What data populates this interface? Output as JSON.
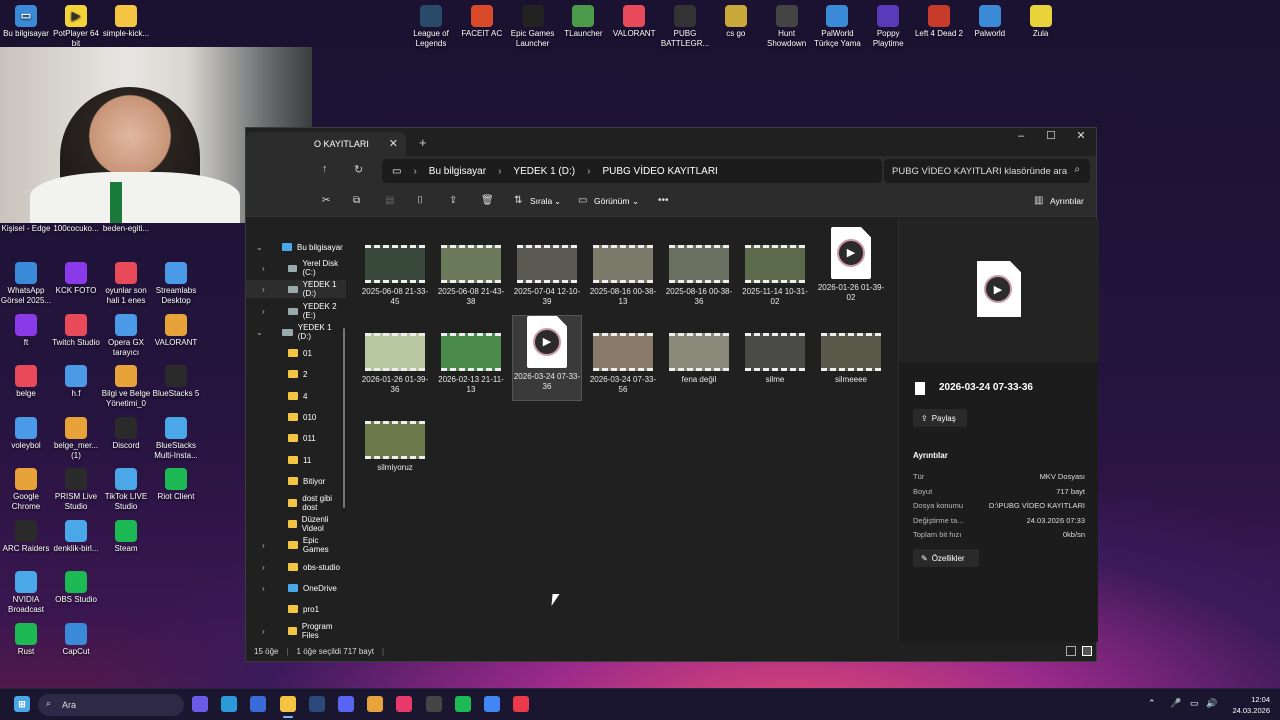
{
  "desktop": {
    "top_left_icons": [
      "Bu bilgisayar",
      "PotPlayer 64 bit",
      "simple-kick..."
    ],
    "top_apps": [
      "League of Legends",
      "FACEIT AC",
      "Epic Games Launcher",
      "TLauncher",
      "VALORANT",
      "PUBG BATTLEGR...",
      "cs go",
      "Hunt Showdown",
      "PalWorld Türkçe Yama",
      "Poppy Playtime",
      "Left 4 Dead 2",
      "Palworld",
      "Zula"
    ],
    "left_row0": [
      "Kişisel - Edge",
      "100cocuko...",
      "beden-egiti..."
    ],
    "left_grid": [
      [
        "WhatsApp Görsel 2025...",
        "KCK FOTO",
        "oyunlar son hali 1 enes",
        "Streamlabs Desktop"
      ],
      [
        "ft",
        "Twitch Studio",
        "Opera GX tarayıcı",
        "VALORANT"
      ],
      [
        "belge",
        "h.f",
        "Bilgi ve Belge Yönetimi_0",
        "BlueStacks 5"
      ],
      [
        "voleybol",
        "belge_mer... (1)",
        "Discord",
        "BlueStacks Multi-Insta..."
      ],
      [
        "Google Chrome",
        "PRISM Live Studio",
        "TikTok LIVE Studio",
        "Riot Client"
      ],
      [
        "ARC Raiders",
        "denklik-birl...",
        "Steam",
        ""
      ],
      [
        "NVIDIA Broadcast",
        "OBS Studio",
        "",
        ""
      ],
      [
        "Rust",
        "CapCut",
        "",
        ""
      ]
    ]
  },
  "explorer": {
    "tab_title": "O KAYITLARI",
    "breadcrumb": [
      "Bu bilgisayar",
      "YEDEK 1 (D:)",
      "PUBG VİDEO KAYITLARI"
    ],
    "search_placeholder": "PUBG VİDEO KAYITLARI klasöründe ara",
    "sort_label": "Sırala",
    "view_label": "Görünüm",
    "details_toggle": "Ayrıntılar",
    "nav": [
      {
        "label": "Bu bilgisayar",
        "type": "pc",
        "expanded": true
      },
      {
        "label": "Yerel Disk (C:)",
        "type": "drive"
      },
      {
        "label": "YEDEK 1 (D:)",
        "type": "drive",
        "selected": true
      },
      {
        "label": "YEDEK 2 (E:)",
        "type": "drive"
      },
      {
        "label": "YEDEK 1 (D:)",
        "type": "drive",
        "expanded": true
      },
      {
        "label": "01",
        "type": "folder"
      },
      {
        "label": "2",
        "type": "folder"
      },
      {
        "label": "4",
        "type": "folder"
      },
      {
        "label": "010",
        "type": "folder"
      },
      {
        "label": "011",
        "type": "folder"
      },
      {
        "label": "11",
        "type": "folder"
      },
      {
        "label": "Bitiyor",
        "type": "folder"
      },
      {
        "label": "dost gibi dost",
        "type": "folder"
      },
      {
        "label": "Düzenli Videol",
        "type": "folder"
      },
      {
        "label": "Epic Games",
        "type": "folder"
      },
      {
        "label": "obs-studio",
        "type": "folder"
      },
      {
        "label": "OneDrive",
        "type": "cloud"
      },
      {
        "label": "pro1",
        "type": "folder"
      },
      {
        "label": "Program Files",
        "type": "folder"
      }
    ],
    "files": [
      {
        "name": "2025-06-08 21-33-45",
        "kind": "video",
        "color": "#3a4a3a"
      },
      {
        "name": "2025-06-08 21-43-38",
        "kind": "video",
        "color": "#6a7a5a"
      },
      {
        "name": "2025-07-04 12-10-39",
        "kind": "video",
        "color": "#5a5a52"
      },
      {
        "name": "2025-08-16 00-38-13",
        "kind": "video",
        "color": "#7a7a6a"
      },
      {
        "name": "2025-08-16 00-38-36",
        "kind": "video",
        "color": "#6a7060"
      },
      {
        "name": "2025-11-14 10-31-02",
        "kind": "video",
        "color": "#5a6a4a"
      },
      {
        "name": "2026-01-26 01-39-02",
        "kind": "doc"
      },
      {
        "name": "2026-01-26 01-39-36",
        "kind": "video",
        "color": "#b8c8a0"
      },
      {
        "name": "2026-02-13 21-11-13",
        "kind": "video",
        "color": "#4a8a4a"
      },
      {
        "name": "2026-03-24 07-33-36",
        "kind": "doc",
        "selected": true
      },
      {
        "name": "2026-03-24 07-33-56",
        "kind": "video",
        "color": "#8a7a6a"
      },
      {
        "name": "fena değil",
        "kind": "video",
        "color": "#8a8a7a"
      },
      {
        "name": "silme",
        "kind": "video",
        "color": "#4a4a48"
      },
      {
        "name": "silmeeee",
        "kind": "video",
        "color": "#5a5a4a"
      },
      {
        "name": "silmiyoruz",
        "kind": "video",
        "color": "#6a7a4a"
      }
    ],
    "details": {
      "filename": "2026-03-24 07-33-36",
      "share": "Paylaş",
      "section": "Ayrıntılar",
      "rows": [
        {
          "k": "Tür",
          "v": "MKV Dosyası"
        },
        {
          "k": "Boyut",
          "v": "717 bayt"
        },
        {
          "k": "Dosya konumu",
          "v": "D:\\PUBG VİDEO KAYITLARI"
        },
        {
          "k": "Değiştirme ta...",
          "v": "24.03.2026 07:33"
        },
        {
          "k": "Toplam bit hızı",
          "v": "0kb/sn"
        }
      ],
      "properties": "Özellikler"
    },
    "status": {
      "count": "15 öğe",
      "selected": "1 öğe seçildi  717 bayt"
    }
  },
  "taskbar": {
    "search": "Ara",
    "time": "12:04",
    "date": "24.03.2026",
    "apps": [
      {
        "name": "copilot",
        "color": "#6a5ae8"
      },
      {
        "name": "edge",
        "color": "#2a9ad8"
      },
      {
        "name": "store",
        "color": "#3a6ad8"
      },
      {
        "name": "explorer",
        "color": "#f4c542"
      },
      {
        "name": "steam",
        "color": "#2a4a7a"
      },
      {
        "name": "discord",
        "color": "#5865f2"
      },
      {
        "name": "chrome",
        "color": "#e8a23a"
      },
      {
        "name": "tiktok",
        "color": "#e83a6a"
      },
      {
        "name": "obs",
        "color": "#444"
      },
      {
        "name": "spotify",
        "color": "#1db954"
      },
      {
        "name": "chrome2",
        "color": "#4285f4"
      },
      {
        "name": "valorant",
        "color": "#ea3a4a"
      }
    ]
  }
}
